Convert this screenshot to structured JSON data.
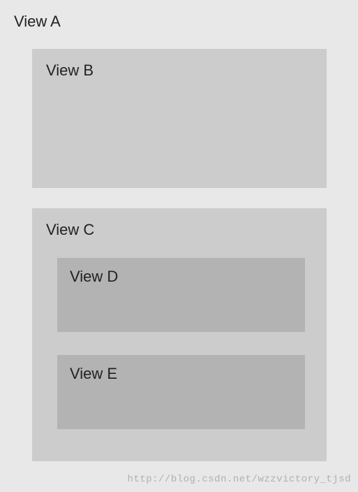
{
  "views": {
    "a": {
      "label": "View A"
    },
    "b": {
      "label": "View B"
    },
    "c": {
      "label": "View C"
    },
    "d": {
      "label": "View D"
    },
    "e": {
      "label": "View E"
    }
  },
  "watermark": "http://blog.csdn.net/wzzvictory_tjsd",
  "colors": {
    "background": "#e8e8e8",
    "level1": "#cccccc",
    "level2": "#b3b3b3"
  }
}
